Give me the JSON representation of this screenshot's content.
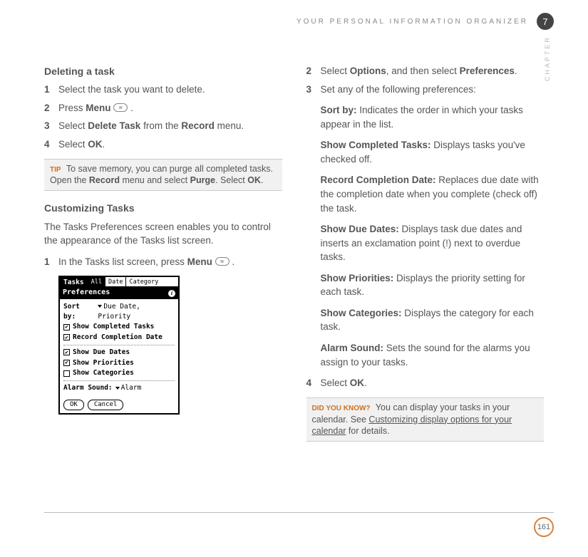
{
  "running_head": "YOUR PERSONAL INFORMATION ORGANIZER",
  "chapter_num": "7",
  "chapter_label": "CHAPTER",
  "page_num": "161",
  "left": {
    "h1": "Deleting a task",
    "s1": {
      "n": "1",
      "t": "Select the task you want to delete."
    },
    "s2": {
      "n": "2",
      "pre": "Press ",
      "b": "Menu",
      "post": " "
    },
    "s3": {
      "n": "3",
      "pre": "Select ",
      "b1": "Delete Task",
      "mid": " from the ",
      "b2": "Record",
      "post": " menu."
    },
    "s4": {
      "n": "4",
      "pre": "Select ",
      "b": "OK",
      "post": "."
    },
    "tip": {
      "label": "TIP",
      "t1": "To save memory, you can purge all completed tasks. Open the ",
      "b1": "Record",
      "t2": " menu and select ",
      "b2": "Purge",
      "t3": ". Select ",
      "b3": "OK",
      "t4": "."
    },
    "h2": "Customizing Tasks",
    "p1": "The Tasks Preferences screen enables you to control the appearance of the Tasks list screen.",
    "s5": {
      "n": "1",
      "pre": "In the Tasks list screen, press ",
      "b": "Menu",
      "post": " "
    }
  },
  "palm": {
    "title": "Tasks",
    "tabs": {
      "all": "All",
      "date": "Date",
      "cat": "Category"
    },
    "subtitle": "Preferences",
    "sortby_label": "Sort by:",
    "sortby_value": "Due Date, Priority",
    "chk1": "Show Completed Tasks",
    "chk2": "Record Completion Date",
    "chk3": "Show Due Dates",
    "chk4": "Show Priorities",
    "chk5": "Show Categories",
    "alarm_label": "Alarm Sound:",
    "alarm_value": "Alarm",
    "ok": "OK",
    "cancel": "Cancel"
  },
  "right": {
    "s2": {
      "n": "2",
      "pre": "Select ",
      "b1": "Options",
      "mid": ", and then select ",
      "b2": "Preferences",
      "post": "."
    },
    "s3": {
      "n": "3",
      "t": "Set any of the following preferences:"
    },
    "defs": {
      "d1": {
        "b": "Sort by:",
        "t": " Indicates the order in which your tasks appear in the list."
      },
      "d2": {
        "b": "Show Completed Tasks:",
        "t": " Displays tasks you've checked off."
      },
      "d3": {
        "b": "Record Completion Date:",
        "t": " Replaces due date with the completion date when you complete (check off) the task."
      },
      "d4": {
        "b": "Show Due Dates:",
        "t": " Displays task due dates and inserts an exclamation point (!) next to overdue tasks."
      },
      "d5": {
        "b": "Show Priorities:",
        "t": " Displays the priority setting for each task."
      },
      "d6": {
        "b": "Show Categories:",
        "t": " Displays the category for each task."
      },
      "d7": {
        "b": "Alarm Sound:",
        "t": " Sets the sound for the alarms you assign to your tasks."
      }
    },
    "s4": {
      "n": "4",
      "pre": "Select ",
      "b": "OK",
      "post": "."
    },
    "dyk": {
      "label": "DID YOU KNOW?",
      "t1": "You can display your tasks in your calendar. See ",
      "link": "Customizing display options for your calendar",
      "t2": " for details."
    }
  }
}
